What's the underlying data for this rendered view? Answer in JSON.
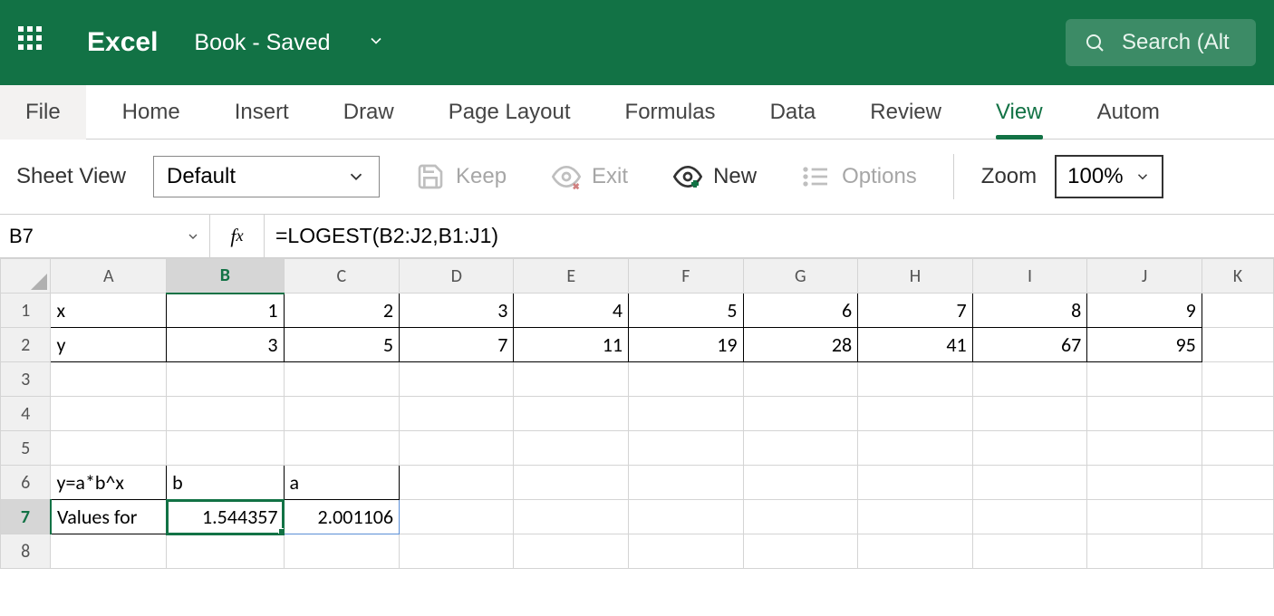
{
  "header": {
    "app_name": "Excel",
    "doc_name": "Book",
    "doc_status": "Saved",
    "search_placeholder": "Search (Alt"
  },
  "tabs": {
    "file": "File",
    "items": [
      "Home",
      "Insert",
      "Draw",
      "Page Layout",
      "Formulas",
      "Data",
      "Review",
      "View",
      "Autom"
    ],
    "active": "View"
  },
  "toolbar": {
    "sheet_view_label": "Sheet View",
    "sheet_view_value": "Default",
    "keep_label": "Keep",
    "exit_label": "Exit",
    "new_label": "New",
    "options_label": "Options",
    "zoom_label": "Zoom",
    "zoom_value": "100%"
  },
  "formula_bar": {
    "name_box": "B7",
    "formula": "=LOGEST(B2:J2,B1:J1)"
  },
  "columns": [
    "A",
    "B",
    "C",
    "D",
    "E",
    "F",
    "G",
    "H",
    "I",
    "J",
    "K"
  ],
  "rows": [
    "1",
    "2",
    "3",
    "4",
    "5",
    "6",
    "7",
    "8"
  ],
  "cells": {
    "A1": "x",
    "B1": "1",
    "C1": "2",
    "D1": "3",
    "E1": "4",
    "F1": "5",
    "G1": "6",
    "H1": "7",
    "I1": "8",
    "J1": "9",
    "A2": "y",
    "B2": "3",
    "C2": "5",
    "D2": "7",
    "E2": "11",
    "F2": "19",
    "G2": "28",
    "H2": "41",
    "I2": "67",
    "J2": "95",
    "A6": "y=a*b^x",
    "B6": "b",
    "C6": "a",
    "A7": "Values for",
    "B7": "1.544357",
    "C7": "2.001106"
  }
}
